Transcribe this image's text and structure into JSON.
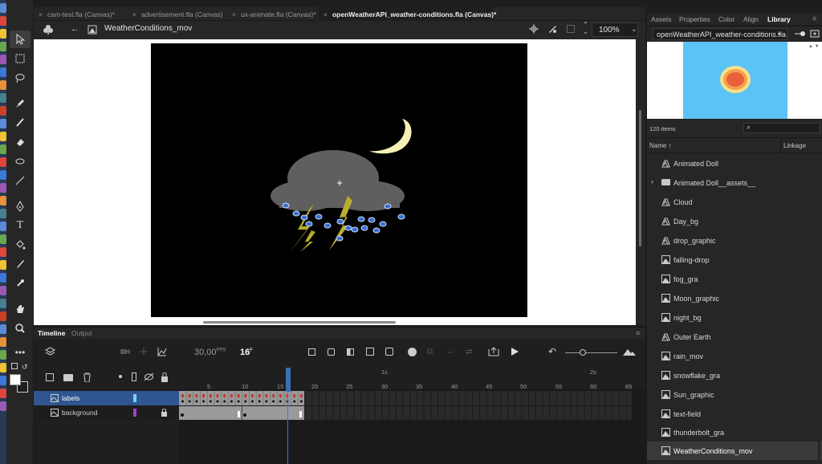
{
  "tabs": [
    {
      "label": "cam-test.fla (Canvas)*",
      "active": false
    },
    {
      "label": "advertisement.fla (Canvas)",
      "active": false
    },
    {
      "label": "ux-animate.fla (Canvas)*",
      "active": false
    },
    {
      "label": "openWeatherAPI_weather-conditions.fla (Canvas)*",
      "active": true
    }
  ],
  "editbar": {
    "scene_name": "WeatherConditions_mov",
    "zoom": "100%"
  },
  "timeline": {
    "tabs": [
      "Timeline",
      "Output"
    ],
    "fps_value": "30,00",
    "fps_unit": "FPS",
    "current_frame": "16",
    "frame_unit": "F",
    "seconds_marks": [
      "1s",
      "2s"
    ],
    "frame_numbers": [
      "5",
      "10",
      "15",
      "20",
      "25",
      "30",
      "35",
      "40",
      "45",
      "50",
      "55",
      "60",
      "65"
    ],
    "layers": [
      {
        "name": "labels",
        "selected": true,
        "color": "#74d0ff"
      },
      {
        "name": "background",
        "selected": false,
        "color": "#a040c8"
      }
    ],
    "playhead_frame": 16
  },
  "right_panel": {
    "tabs": [
      "Assets",
      "Properties",
      "Color",
      "Align",
      "Library"
    ],
    "active_tab": "Library",
    "document": "openWeatherAPI_weather-conditions.fla",
    "item_count": "120 items",
    "columns": {
      "name": "Name",
      "linkage": "Linkage"
    },
    "items": [
      {
        "name": "Animated Doll",
        "type": "graphic"
      },
      {
        "name": "Animated Doll__assets__",
        "type": "folder"
      },
      {
        "name": "Cloud",
        "type": "graphic"
      },
      {
        "name": "Day_bg",
        "type": "graphic"
      },
      {
        "name": "drop_graphic",
        "type": "graphic"
      },
      {
        "name": "falling-drop",
        "type": "movieclip"
      },
      {
        "name": "fog_gra",
        "type": "movieclip"
      },
      {
        "name": "Moon_graphic",
        "type": "movieclip"
      },
      {
        "name": "night_bg",
        "type": "movieclip"
      },
      {
        "name": "Outer Earth",
        "type": "graphic"
      },
      {
        "name": "rain_mov",
        "type": "movieclip"
      },
      {
        "name": "snowflake_gra",
        "type": "movieclip"
      },
      {
        "name": "Sun_graphic",
        "type": "movieclip"
      },
      {
        "name": "text-field",
        "type": "movieclip"
      },
      {
        "name": "thunderbolt_gra",
        "type": "movieclip"
      },
      {
        "name": "WeatherConditions_mov",
        "type": "movieclip",
        "selected": true
      }
    ]
  },
  "colors": {
    "accent": "#3b6fb5",
    "stage": "#000000",
    "cloud": "#5f5f5f",
    "moon": "#f6f0b6",
    "bolt": "#b7ad2f",
    "preview_sky": "#5bc4f5"
  }
}
